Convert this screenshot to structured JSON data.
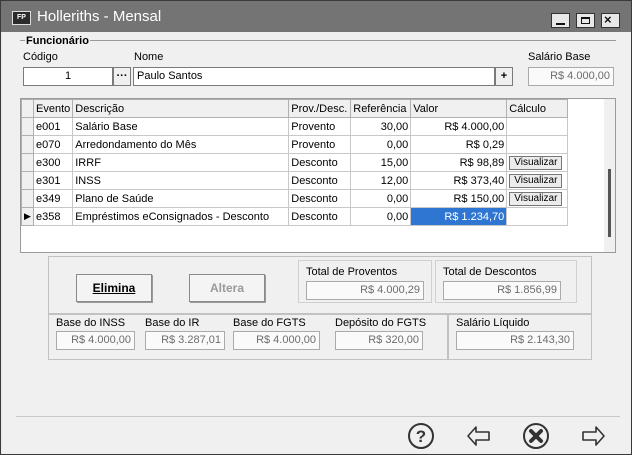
{
  "window": {
    "title": "Holleriths - Mensal",
    "icon_text": "FP",
    "minimize_glyph": "",
    "close_glyph": "×"
  },
  "funcionario": {
    "group_title": "Funcionário",
    "codigo_label": "Código",
    "codigo_value": "1",
    "lookup_glyph": "···",
    "nome_label": "Nome",
    "nome_value": "Paulo Santos",
    "add_glyph": "+",
    "salario_base_label": "Salário Base",
    "salario_base_value": "R$ 4.000,00"
  },
  "grid": {
    "columns": [
      "Evento",
      "Descrição",
      "Prov./Desc.",
      "Referência",
      "Valor",
      "Cálculo"
    ],
    "current_row_marker": "▶",
    "rows": [
      {
        "evento": "e001",
        "descricao": "Salário Base",
        "tipo": "Provento",
        "referencia": "30,00",
        "valor": "R$ 4.000,00",
        "calculo": ""
      },
      {
        "evento": "e070",
        "descricao": "Arredondamento do Mês",
        "tipo": "Provento",
        "referencia": "0,00",
        "valor": "R$ 0,29",
        "calculo": ""
      },
      {
        "evento": "e300",
        "descricao": "IRRF",
        "tipo": "Desconto",
        "referencia": "15,00",
        "valor": "R$ 98,89",
        "calculo": "Visualizar"
      },
      {
        "evento": "e301",
        "descricao": "INSS",
        "tipo": "Desconto",
        "referencia": "12,00",
        "valor": "R$ 373,40",
        "calculo": "Visualizar"
      },
      {
        "evento": "e349",
        "descricao": "Plano de Saúde",
        "tipo": "Desconto",
        "referencia": "0,00",
        "valor": "R$ 150,00",
        "calculo": "Visualizar"
      },
      {
        "evento": "e358",
        "descricao": "Empréstimos eConsignados - Desconto",
        "tipo": "Desconto",
        "referencia": "0,00",
        "valor": "R$ 1.234,70",
        "calculo": ""
      }
    ]
  },
  "actions": {
    "elimina_label": "Elimina",
    "altera_label": "Altera"
  },
  "totais": {
    "proventos_label": "Total de Proventos",
    "proventos_value": "R$ 4.000,29",
    "descontos_label": "Total de Descontos",
    "descontos_value": "R$ 1.856,99"
  },
  "bases": {
    "inss_label": "Base do INSS",
    "inss_value": "R$ 4.000,00",
    "ir_label": "Base do IR",
    "ir_value": "R$ 3.287,01",
    "fgts_label": "Base do FGTS",
    "fgts_value": "R$ 4.000,00",
    "deposito_label": "Depósito do FGTS",
    "deposito_value": "R$ 320,00",
    "liquido_label": "Salário Líquido",
    "liquido_value": "R$ 2.143,30"
  },
  "icons": {
    "help": "help-icon",
    "back": "back-arrow-icon",
    "cancel": "cancel-icon",
    "forward": "forward-arrow-icon"
  },
  "colors": {
    "selection": "#2f76d2",
    "titlebar": "#747474"
  }
}
